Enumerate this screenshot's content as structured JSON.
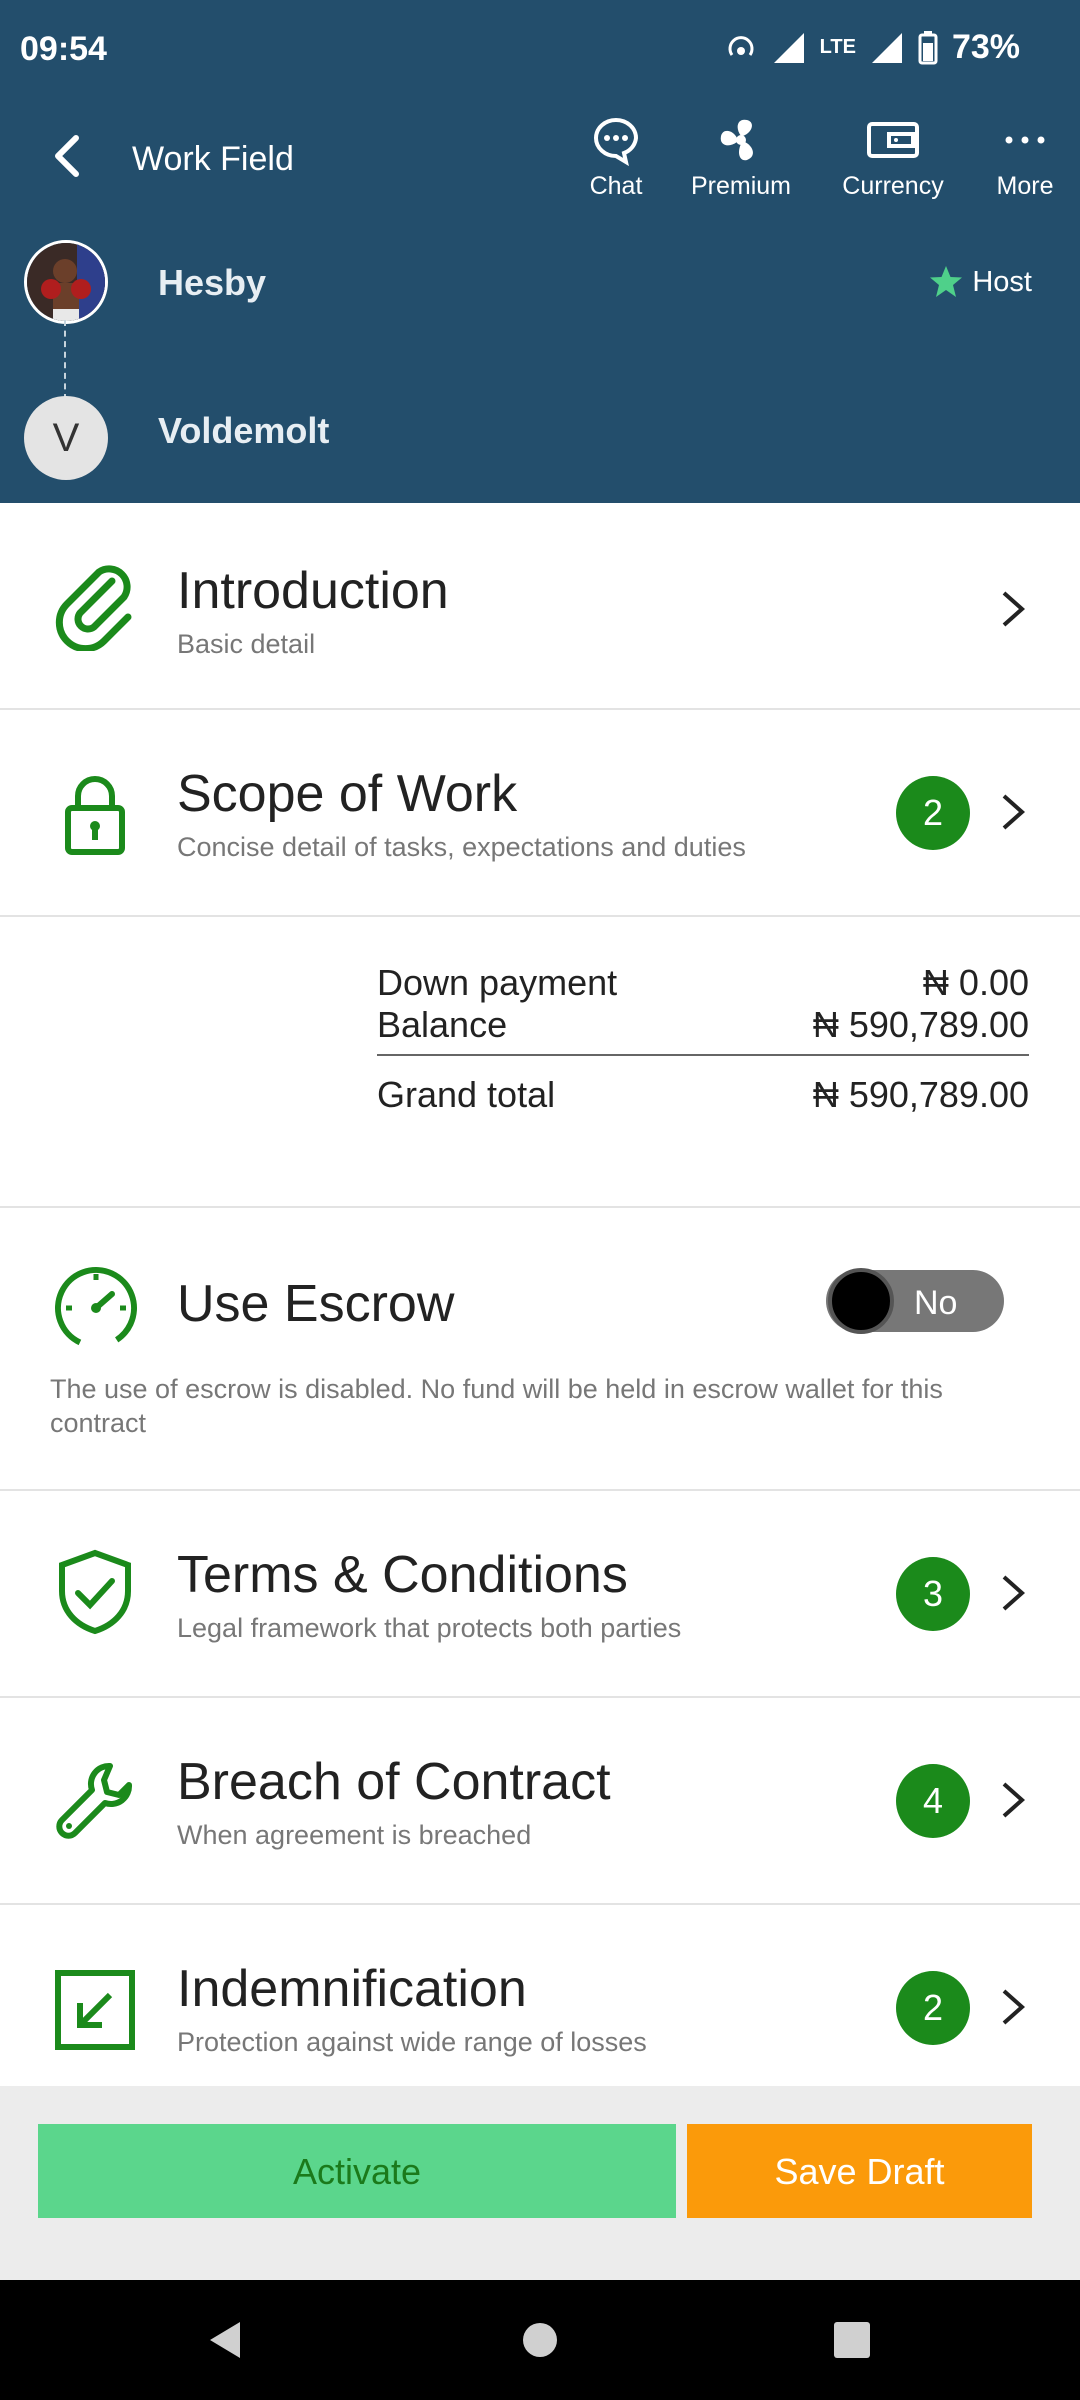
{
  "status_bar": {
    "time": "09:54",
    "battery": "73%",
    "network": "LTE"
  },
  "header": {
    "title": "Work Field",
    "actions": [
      {
        "label": "Chat",
        "icon": "chat-icon"
      },
      {
        "label": "Premium",
        "icon": "fan-icon"
      },
      {
        "label": "Currency",
        "icon": "wallet-icon"
      },
      {
        "label": "More",
        "icon": "more-icon"
      }
    ],
    "parties": [
      {
        "name": "Hesby",
        "role": "Host"
      },
      {
        "name": "Voldemolt",
        "initial": "V"
      }
    ]
  },
  "sections": {
    "introduction": {
      "title": "Introduction",
      "subtitle": "Basic detail"
    },
    "scope": {
      "title": "Scope of Work",
      "subtitle": "Concise detail of tasks, expectations and duties",
      "badge": "2"
    },
    "terms": {
      "title": "Terms & Conditions",
      "subtitle": "Legal framework that protects both parties",
      "badge": "3"
    },
    "breach": {
      "title": "Breach of Contract",
      "subtitle": "When agreement is breached",
      "badge": "4"
    },
    "indemnification": {
      "title": "Indemnification",
      "subtitle": "Protection against wide range of losses",
      "badge": "2"
    }
  },
  "totals": {
    "down_payment_label": "Down payment",
    "down_payment_value": "₦ 0.00",
    "balance_label": "Balance",
    "balance_value": "₦ 590,789.00",
    "grand_total_label": "Grand total",
    "grand_total_value": "₦ 590,789.00"
  },
  "escrow": {
    "title": "Use Escrow",
    "toggle_label": "No",
    "description": "The use of escrow is disabled. No fund will be held in escrow wallet for this contract"
  },
  "buttons": {
    "activate": "Activate",
    "save_draft": "Save Draft"
  },
  "colors": {
    "header": "#234e6c",
    "accent_green": "#1b8a1b",
    "activate_bg": "#5bd68c",
    "save_bg": "#fb9a0a"
  }
}
